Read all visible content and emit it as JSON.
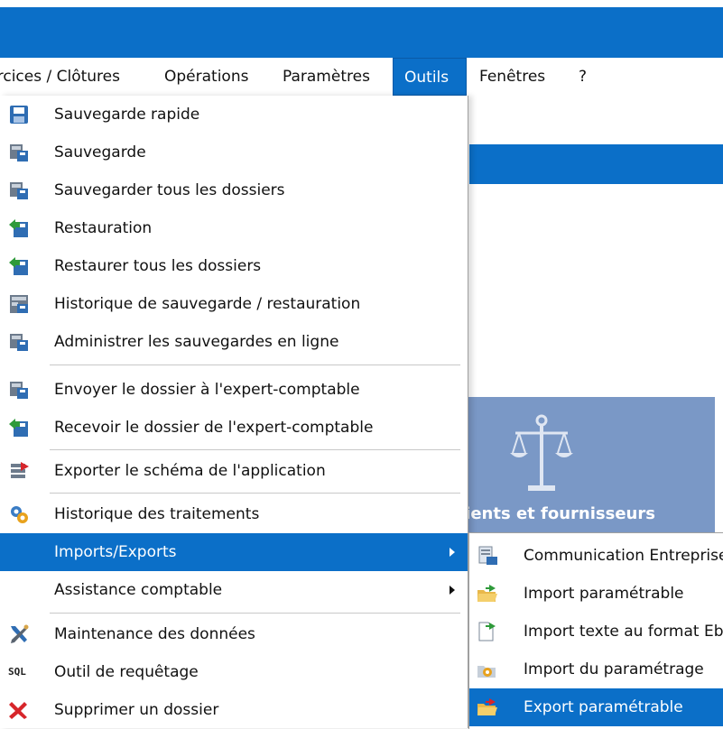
{
  "menubar": {
    "items": [
      {
        "label": "Exercices / Clôtures"
      },
      {
        "label": "Opérations"
      },
      {
        "label": "Paramètres"
      },
      {
        "label": "Outils",
        "active": true
      },
      {
        "label": "Fenêtres"
      },
      {
        "label": "?"
      }
    ]
  },
  "background": {
    "tile_label": "Relations clients et fournisseurs",
    "tile_icon": "scale-icon"
  },
  "outils_menu": {
    "items": [
      {
        "label": "Sauvegarde rapide",
        "icon": "save-floppy-icon"
      },
      {
        "label": "Sauvegarde",
        "icon": "save-disk-icon"
      },
      {
        "label": "Sauvegarder tous les dossiers",
        "icon": "save-all-icon"
      },
      {
        "label": "Restauration",
        "icon": "restore-icon"
      },
      {
        "label": "Restaurer tous les dossiers",
        "icon": "restore-all-icon"
      },
      {
        "label": "Historique de sauvegarde / restauration",
        "icon": "backup-history-icon"
      },
      {
        "label": "Administrer les sauvegardes en ligne",
        "icon": "online-backup-icon"
      },
      {
        "label": "Envoyer le dossier à l'expert-comptable",
        "icon": "send-folder-icon"
      },
      {
        "label": "Recevoir le dossier de l'expert-comptable",
        "icon": "receive-folder-icon"
      },
      {
        "label": "Exporter le schéma de l'application",
        "icon": "export-schema-icon"
      },
      {
        "label": "Historique des traitements",
        "icon": "gear-history-icon"
      },
      {
        "label": "Imports/Exports",
        "submenu": true,
        "highlighted": true
      },
      {
        "label": "Assistance comptable",
        "submenu": true
      },
      {
        "label": "Maintenance des données",
        "icon": "tools-icon"
      },
      {
        "label": "Outil de requêtage",
        "icon": "sql-icon",
        "icon_text": "SQL"
      },
      {
        "label": "Supprimer un dossier",
        "icon": "delete-icon"
      }
    ]
  },
  "imports_exports_submenu": {
    "items": [
      {
        "label": "Communication Entreprise",
        "icon": "communication-icon"
      },
      {
        "label": "Import paramétrable",
        "icon": "import-folder-icon"
      },
      {
        "label": "Import texte au format Ebp",
        "icon": "import-text-icon"
      },
      {
        "label": "Import du paramétrage",
        "icon": "import-settings-icon"
      },
      {
        "label": "Export paramétrable",
        "icon": "export-folder-icon",
        "highlighted": true
      }
    ]
  },
  "colors": {
    "accent": "#0b6fc8",
    "tile": "#7a98c6"
  }
}
